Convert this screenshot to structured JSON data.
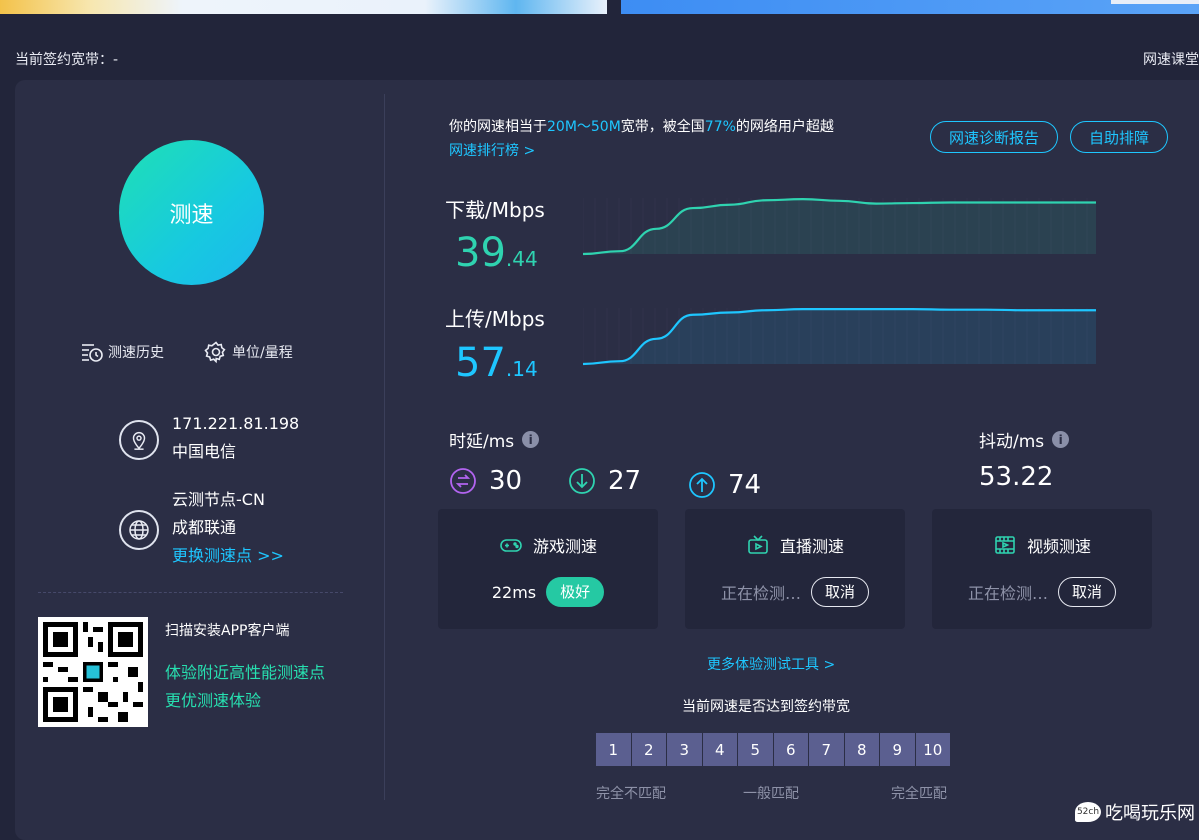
{
  "header": {
    "contract_label": "当前签约宽带：-",
    "course_link": "网速课堂"
  },
  "left": {
    "start_button": "测速",
    "history_label": "测速历史",
    "unit_label": "单位/量程",
    "ip": "171.221.81.198",
    "isp": "中国电信",
    "node_name": "云测节点-CN",
    "node_isp": "成都联通",
    "change_node": "更换测速点 >>",
    "qr_title": "扫描安装APP客户端",
    "qr_line1": "体验附近高性能测速点",
    "qr_line2": "更优测速体验"
  },
  "summary": {
    "prefix": "你的网速相当于",
    "range": "20M～50M",
    "mid": "宽带，被全国",
    "percent": "77%",
    "suffix": "的网络用户超越",
    "rank_link": "网速排行榜 >",
    "report_button": "网速诊断报告",
    "troubleshoot_button": "自助排障"
  },
  "download": {
    "label": "下载/Mbps",
    "int": "39",
    "dec": ".44",
    "color": "#2fd3b0",
    "curve": [
      0.0,
      0.05,
      0.45,
      0.82,
      0.88,
      0.96,
      0.98,
      0.95,
      0.9,
      0.91,
      0.92,
      0.92,
      0.92,
      0.92,
      0.92
    ]
  },
  "upload": {
    "label": "上传/Mbps",
    "int": "57",
    "dec": ".14",
    "color": "#1ec6ff",
    "curve": [
      0.0,
      0.05,
      0.45,
      0.88,
      0.92,
      0.96,
      0.98,
      0.98,
      0.98,
      0.98,
      0.97,
      0.97,
      0.96,
      0.96,
      0.96
    ]
  },
  "latency": {
    "label": "时延/ms",
    "values": [
      "30",
      "27",
      "74"
    ],
    "colors": [
      "#b264f0",
      "#2fd3b0",
      "#1ec6ff"
    ]
  },
  "jitter": {
    "label": "抖动/ms",
    "value": "53.22"
  },
  "cards": {
    "game": {
      "title": "游戏测速",
      "latency": "22ms",
      "badge": "极好"
    },
    "live": {
      "title": "直播测速",
      "status": "正在检测…",
      "cancel": "取消"
    },
    "video": {
      "title": "视频测速",
      "status": "正在检测…",
      "cancel": "取消"
    }
  },
  "more_tools": "更多体验测试工具 >",
  "match": {
    "title": "当前网速是否达到签约带宽",
    "scale": [
      "1",
      "2",
      "3",
      "4",
      "5",
      "6",
      "7",
      "8",
      "9",
      "10"
    ],
    "low": "完全不匹配",
    "mid": "一般匹配",
    "high": "完全匹配"
  },
  "watermark": {
    "icon_text": "52ch",
    "text": "吃喝玩乐网"
  }
}
